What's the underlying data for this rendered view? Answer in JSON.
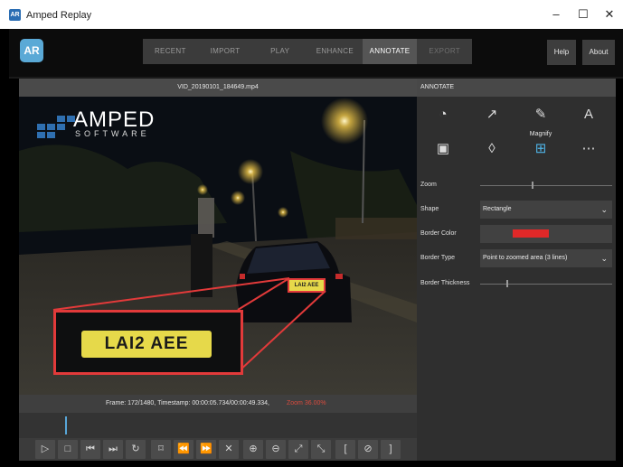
{
  "window": {
    "title": "Amped Replay",
    "minimize": "–",
    "maximize": "☐",
    "close": "✕",
    "icon_text": "AR"
  },
  "app": {
    "logo_text": "AR"
  },
  "nav": {
    "tabs": [
      {
        "label": "RECENT",
        "state": "normal"
      },
      {
        "label": "IMPORT",
        "state": "normal"
      },
      {
        "label": "PLAY",
        "state": "normal"
      },
      {
        "label": "ENHANCE",
        "state": "normal"
      },
      {
        "label": "ANNOTATE",
        "state": "active"
      },
      {
        "label": "EXPORT",
        "state": "dim"
      }
    ],
    "help_label": "Help",
    "about_label": "About"
  },
  "video": {
    "filename": "VID_20190101_184649.mp4",
    "watermark_top": "AMPED",
    "watermark_bottom": "SOFTWARE",
    "plate_small": "LAI2 AEE",
    "plate_zoomed": "LAI2 AEE",
    "status_frame": "Frame: 172/1480, Timestamp: 00:00:05.734/00:00:49.334,",
    "status_zoom": "Zoom 36.00%",
    "timeline_progress": 0.116
  },
  "controls": {
    "buttons": [
      {
        "name": "play-button",
        "icon": "▷"
      },
      {
        "name": "stop-button",
        "icon": "□"
      },
      {
        "name": "previous-frame-button",
        "icon": "⏮"
      },
      {
        "name": "next-frame-button",
        "icon": "⏭"
      },
      {
        "name": "loop-button",
        "icon": "↻"
      },
      {
        "name": "bookmark-button",
        "icon": "⌑"
      },
      {
        "name": "rewind-button",
        "icon": "⏪"
      },
      {
        "name": "fast-forward-button",
        "icon": "⏩"
      },
      {
        "name": "close-clip-button",
        "icon": "✕"
      },
      {
        "name": "zoom-in-button",
        "icon": "⊕"
      },
      {
        "name": "zoom-out-button",
        "icon": "⊖"
      },
      {
        "name": "fit-button",
        "icon": "⤢"
      },
      {
        "name": "actual-size-button",
        "icon": "⤡"
      },
      {
        "name": "set-in-point-button",
        "icon": "["
      },
      {
        "name": "clear-range-button",
        "icon": "⊘"
      },
      {
        "name": "set-out-point-button",
        "icon": "]"
      }
    ]
  },
  "annotate": {
    "header": "ANNOTATE",
    "tools": [
      {
        "name": "shape-tool-icon",
        "glyph": "◔"
      },
      {
        "name": "arrow-tool-icon",
        "glyph": "↗"
      },
      {
        "name": "pencil-tool-icon",
        "glyph": "✎"
      },
      {
        "name": "text-tool-icon",
        "glyph": "A"
      },
      {
        "name": "image-tool-icon",
        "glyph": "▣"
      },
      {
        "name": "blur-tool-icon",
        "glyph": "◊"
      },
      {
        "name": "magnify-tool-icon",
        "glyph": "⊞"
      },
      {
        "name": "more-tools-icon",
        "glyph": "⋯"
      }
    ],
    "magnify_label": "Magnify",
    "zoom_label": "Zoom",
    "zoom_level": 0.39,
    "shape_label": "Shape",
    "shape_value": "Rectangle",
    "border_color_label": "Border Color",
    "border_color_value": "#e02828",
    "border_type_label": "Border Type",
    "border_type_value": "Point to zoomed area (3 lines)",
    "border_thickness_label": "Border Thickness",
    "border_thickness_level": 0.2
  },
  "colors": {
    "accent_blue": "#4fb3e6",
    "annotation_red": "#e23a3a",
    "plate_yellow": "#e6d94a"
  }
}
